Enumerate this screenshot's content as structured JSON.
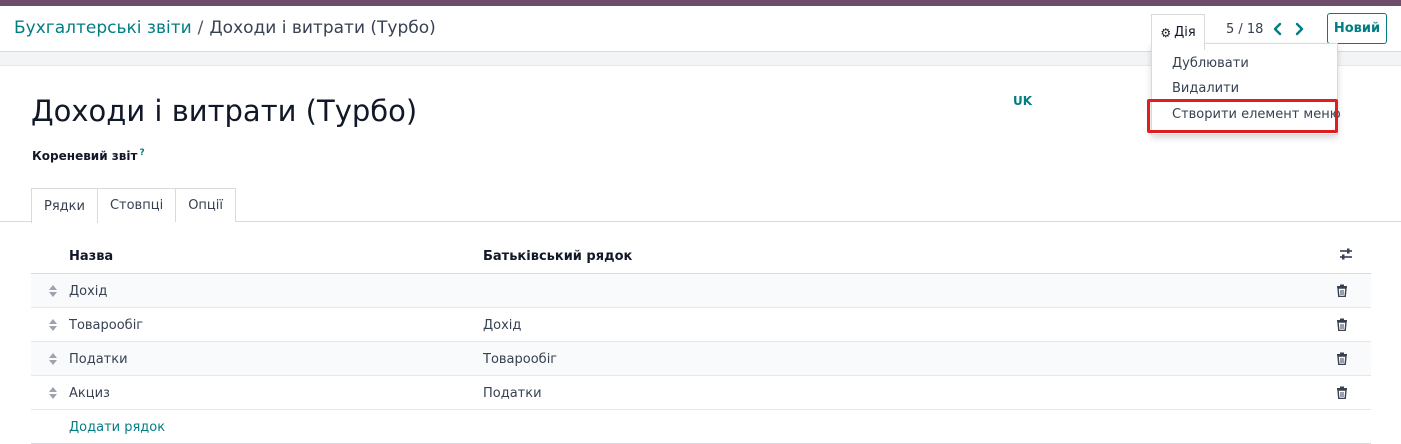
{
  "breadcrumb": {
    "parent": "Бухгалтерські звіти",
    "separator": "/",
    "current": "Доходи і витрати (Турбо)"
  },
  "toolbar": {
    "action_label": "Дія",
    "pager": "5 / 18",
    "new_label": "Новий"
  },
  "action_menu": {
    "items": [
      "Дублювати",
      "Видалити",
      "Створити елемент меню"
    ],
    "highlighted_item": "Створити елемент меню"
  },
  "record": {
    "title": "Доходи і витрати (Турбо)",
    "lang_badge": "UK",
    "root_report_label": "Кореневий звіт",
    "help_mark": "?"
  },
  "tabs": [
    {
      "label": "Рядки",
      "active": true
    },
    {
      "label": "Стовпці",
      "active": false
    },
    {
      "label": "Опції",
      "active": false
    }
  ],
  "lines_table": {
    "columns": [
      "Назва",
      "Батьківський рядок"
    ],
    "rows": [
      {
        "name": "Дохід",
        "parent": ""
      },
      {
        "name": "Товарообіг",
        "parent": "Дохід"
      },
      {
        "name": "Податки",
        "parent": "Товарообіг"
      },
      {
        "name": "Акциз",
        "parent": "Податки"
      }
    ],
    "add_line_label": "Додати рядок"
  },
  "icons": {
    "action": "gear-icon",
    "prev": "chevron-left-icon",
    "next": "chevron-right-icon",
    "optional_columns": "sliders-icon",
    "row_handle": "drag-handle-icon",
    "delete": "trash-icon"
  },
  "colors": {
    "brand": "#6e4c6c",
    "accent": "#017e84",
    "highlight": "#e11d1d"
  }
}
